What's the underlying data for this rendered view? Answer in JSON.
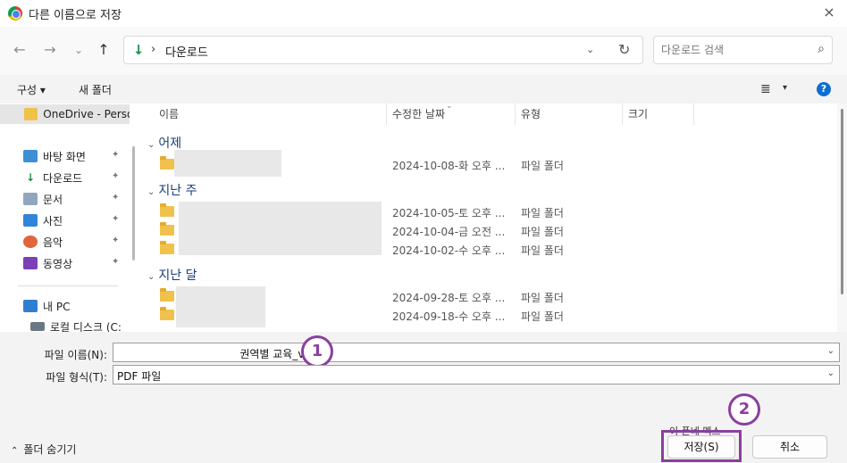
{
  "window": {
    "title": "다른 이름으로 저장",
    "close_icon": "×"
  },
  "nav": {
    "back_icon": "←",
    "forward_icon": "→",
    "recent_icon": "⌄",
    "up_icon": "↑",
    "address": {
      "icon": "download-icon",
      "separator": "›",
      "path": "다운로드",
      "dropdown": "⌄",
      "refresh": "↻"
    },
    "search": {
      "placeholder": "다운로드 검색",
      "icon": "⌕"
    }
  },
  "commandbar": {
    "organize": "구성 ▾",
    "new_folder": "새 폴더",
    "view_icon": "≣",
    "view_dropdown": "▾",
    "help": "?"
  },
  "sidebar": {
    "items": [
      {
        "label": "OneDrive - Perso",
        "icon": "folder"
      },
      {
        "label": "바탕 화면",
        "icon": "desktop",
        "pinned": true
      },
      {
        "label": "다운로드",
        "icon": "download",
        "pinned": true
      },
      {
        "label": "문서",
        "icon": "document",
        "pinned": true
      },
      {
        "label": "사진",
        "icon": "pictures",
        "pinned": true
      },
      {
        "label": "음악",
        "icon": "music",
        "pinned": true
      },
      {
        "label": "동영상",
        "icon": "video",
        "pinned": true
      },
      {
        "label": "내 PC",
        "icon": "pc"
      },
      {
        "label": "로컬 디스크 (C:",
        "icon": "drive"
      }
    ],
    "pin_icon": "📌"
  },
  "columns": {
    "name": "이름",
    "modified": "수정한 날짜",
    "type": "유형",
    "size": "크기",
    "sort_icon": "⌄"
  },
  "groups": [
    {
      "label": "어제",
      "rows": [
        {
          "date": "2024-10-08-화 오후 ...",
          "type": "파일 폴더"
        }
      ]
    },
    {
      "label": "지난 주",
      "rows": [
        {
          "date": "2024-10-05-토 오후 ...",
          "type": "파일 폴더"
        },
        {
          "date": "2024-10-04-금 오전 ...",
          "type": "파일 폴더"
        },
        {
          "date": "2024-10-02-수 오후 ...",
          "type": "파일 폴더"
        }
      ]
    },
    {
      "label": "지난 달",
      "rows": [
        {
          "date": "2024-09-28-토 오후 ...",
          "type": "파일 폴더"
        },
        {
          "date": "2024-09-18-수 오후 ...",
          "type": "파일 폴더"
        }
      ]
    }
  ],
  "save": {
    "filename_label": "파일 이름(N):",
    "filename_value": "                                    권역별 교육_v1.0",
    "filetype_label": "파일 형식(T):",
    "filetype_value": "PDF 파일",
    "dropdown_icon": "⌄",
    "hide_folders": "폴더 숨기기",
    "hide_chevron": "⌃",
    "overflow_text": "이 폰네 멕스",
    "save_button": "저장(S)",
    "cancel_button": "취소",
    "badge1": "1",
    "badge2": "2"
  },
  "colors": {
    "accent": "#8a3f9e",
    "help": "#0c6fd0",
    "download": "#1a8f4d",
    "folder": "#f0c24b"
  }
}
